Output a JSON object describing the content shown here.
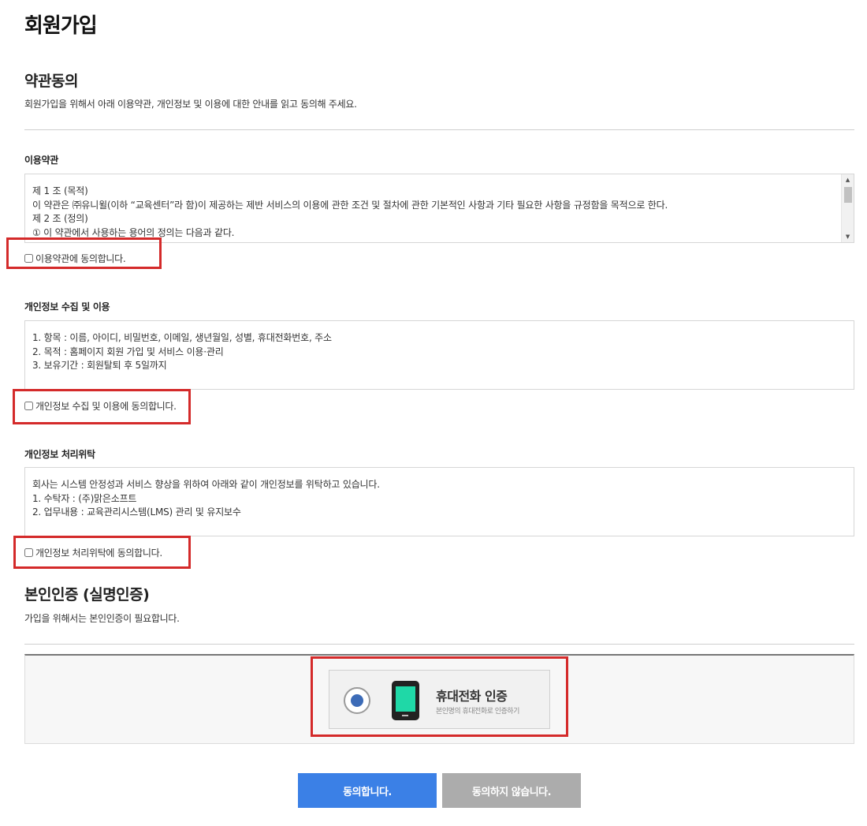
{
  "page": {
    "title": "회원가입"
  },
  "terms_section": {
    "title": "약관동의",
    "description": "회원가입을 위해서 아래 이용약관, 개인정보 및 이용에 대한 안내를 읽고 동의해 주세요."
  },
  "terms_of_use": {
    "title": "이용약관",
    "lines": [
      "제 1 조 (목적)",
      "이 약관은 ㈜유니윌(이하 “교육센터”라 함)이 제공하는 제반 서비스의 이용에 관한 조건 및 절차에 관한 기본적인 사항과 기타 필요한 사항을 규정함을 목적으로 한다.",
      "제 2 조 (정의)",
      "① 이 약관에서 사용하는 용어의 정의는 다음과 같다."
    ],
    "agree_label": "이용약관에 동의합니다."
  },
  "privacy_collection": {
    "title": "개인정보 수집 및 이용",
    "lines": [
      "1. 항목 : 이름, 아이디, 비밀번호, 이메일, 생년월일, 성별, 휴대전화번호, 주소",
      "2. 목적 : 홈페이지 회원 가입 및 서비스 이용·관리",
      "3. 보유기간 : 회원탈퇴 후 5일까지"
    ],
    "agree_label": "개인정보 수집 및 이용에 동의합니다."
  },
  "privacy_outsourcing": {
    "title": "개인정보 처리위탁",
    "lines": [
      "회사는 시스템 안정성과 서비스 향상을 위하여 아래와 같이 개인정보를 위탁하고 있습니다.",
      "1. 수탁자 : (주)맑은소프트",
      "2. 업무내용 : 교육관리시스템(LMS) 관리 및 유지보수"
    ],
    "agree_label": "개인정보 처리위탁에 동의합니다."
  },
  "verification": {
    "title": "본인인증 (실명인증)",
    "description": "가입을 위해서는 본인인증이 필요합니다.",
    "option_title": "휴대전화 인증",
    "option_subtitle": "본인명의 휴대전화로 인증하기",
    "icon": "mobile-phone-icon"
  },
  "buttons": {
    "agree": "동의합니다.",
    "disagree": "동의하지 않습니다."
  },
  "colors": {
    "accent_blue": "#3b80e6",
    "disabled_gray": "#acacac",
    "highlight_red": "#d42a2a",
    "phone_screen": "#1fd8a7",
    "radio_selected": "#3c6bb7"
  }
}
